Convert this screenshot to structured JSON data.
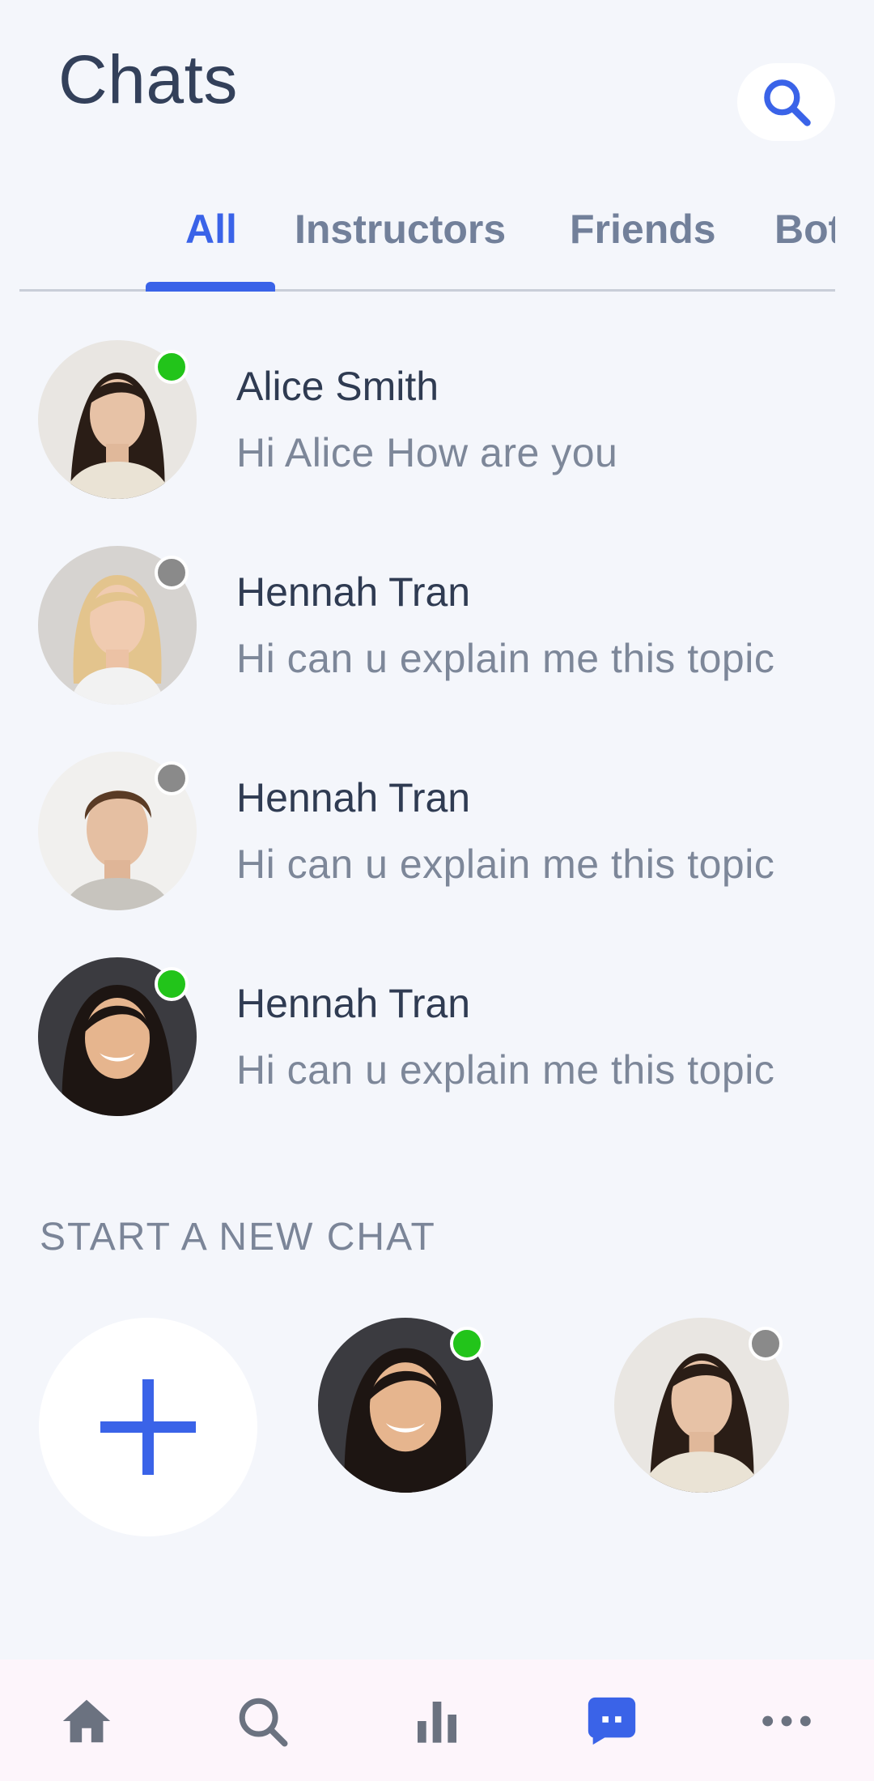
{
  "header": {
    "title": "Chats",
    "search_icon": "search-icon"
  },
  "tabs": [
    {
      "label": "All",
      "active": true
    },
    {
      "label": "Instructors",
      "active": false
    },
    {
      "label": "Friends",
      "active": false
    },
    {
      "label": "Bots",
      "active": false
    }
  ],
  "chats": [
    {
      "name": "Alice Smith",
      "preview": "Hi Alice How are you",
      "status": "online"
    },
    {
      "name": "Hennah Tran",
      "preview": "Hi can u explain me this topic",
      "status": "offline"
    },
    {
      "name": "Hennah Tran",
      "preview": "Hi can u explain me this topic",
      "status": "offline"
    },
    {
      "name": "Hennah Tran",
      "preview": "Hi can u explain me this topic",
      "status": "online"
    }
  ],
  "new_chat": {
    "section_label": "START A NEW CHAT",
    "add_icon": "plus-icon",
    "contacts": [
      {
        "status": "online"
      },
      {
        "status": "offline"
      }
    ]
  },
  "bottom_nav": [
    {
      "icon": "home-icon",
      "active": false
    },
    {
      "icon": "search-icon",
      "active": false
    },
    {
      "icon": "bar-chart-icon",
      "active": false
    },
    {
      "icon": "chat-icon",
      "active": true
    },
    {
      "icon": "more-icon",
      "active": false
    }
  ],
  "colors": {
    "accent": "#3a63e8",
    "online": "#22c41a",
    "offline": "#8a8a8a",
    "background": "#f4f6fb"
  }
}
